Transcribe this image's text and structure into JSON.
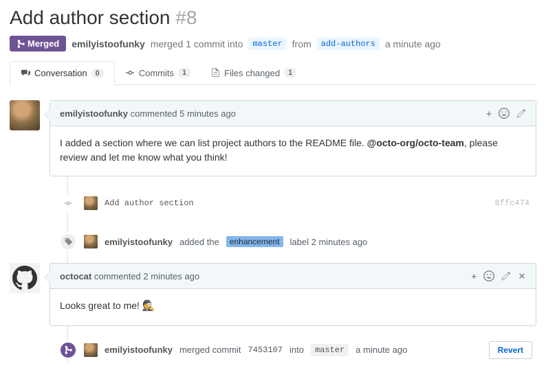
{
  "title": "Add author section",
  "pr_number": "#8",
  "state": {
    "label": "Merged"
  },
  "meta": {
    "actor": "emilyistoofunky",
    "verb": "merged 1 commit into",
    "base_branch": "master",
    "from_word": "from",
    "head_branch": "add-authors",
    "time": "a minute ago"
  },
  "tabs": {
    "conversation": {
      "label": "Conversation",
      "count": "0"
    },
    "commits": {
      "label": "Commits",
      "count": "1"
    },
    "files": {
      "label": "Files changed",
      "count": "1"
    }
  },
  "comment1": {
    "author": "emilyistoofunky",
    "verb": "commented",
    "time": "5 minutes ago",
    "body_pre": "I added a section where we can list project authors to the README file. ",
    "mention": "@octo-org/octo-team",
    "body_post": ", please review and let me know what you think!"
  },
  "commit_event": {
    "message": "Add author section",
    "sha": "8ffc474"
  },
  "label_event": {
    "author": "emilyistoofunky",
    "verb": "added the",
    "label": "enhancement",
    "suffix": "label 2 minutes ago"
  },
  "comment2": {
    "author": "octocat",
    "verb": "commented",
    "time": "2 minutes ago",
    "body": "Looks great to me! "
  },
  "merge_event": {
    "author": "emilyistoofunky",
    "verb": "merged commit",
    "sha": "7453107",
    "into_word": "into",
    "branch": "master",
    "time": "a minute ago"
  },
  "revert_label": "Revert"
}
